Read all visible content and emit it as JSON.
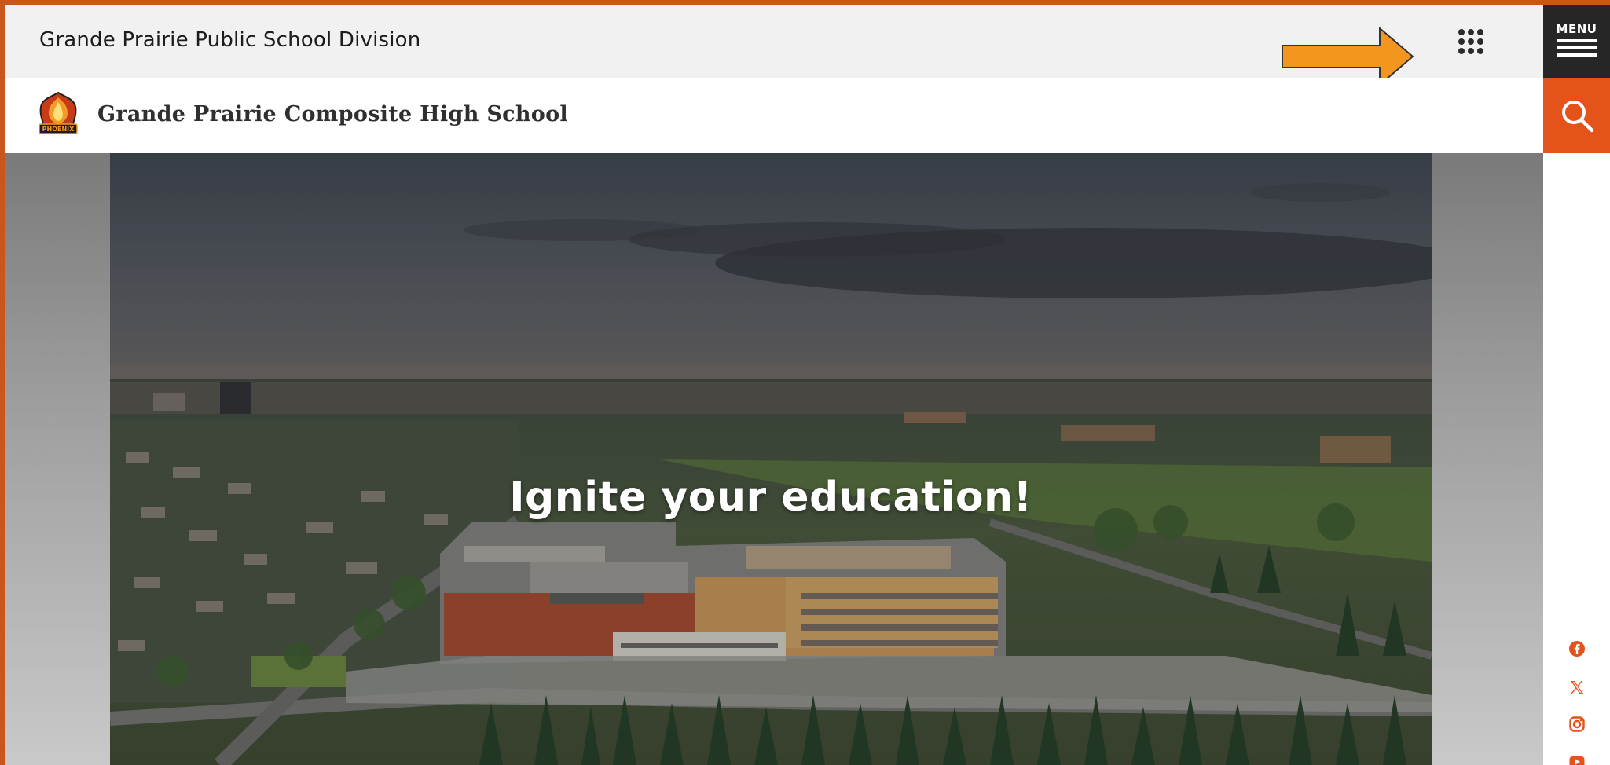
{
  "division": {
    "title": "Grande Prairie Public School Division"
  },
  "menu": {
    "label": "MENU"
  },
  "school": {
    "name": "Grande Prairie Composite High School",
    "logo_text": "PHOENIX"
  },
  "hero": {
    "headline": "Ignite your education!"
  },
  "colors": {
    "accent": "#e3531a",
    "menu_bg": "#262626",
    "arrow": "#f2961f",
    "social": "#e3531a"
  },
  "icons": {
    "apps": "apps-grid-icon",
    "search": "search-icon",
    "social": [
      "facebook-icon",
      "x-icon",
      "instagram-icon",
      "youtube-icon"
    ]
  }
}
